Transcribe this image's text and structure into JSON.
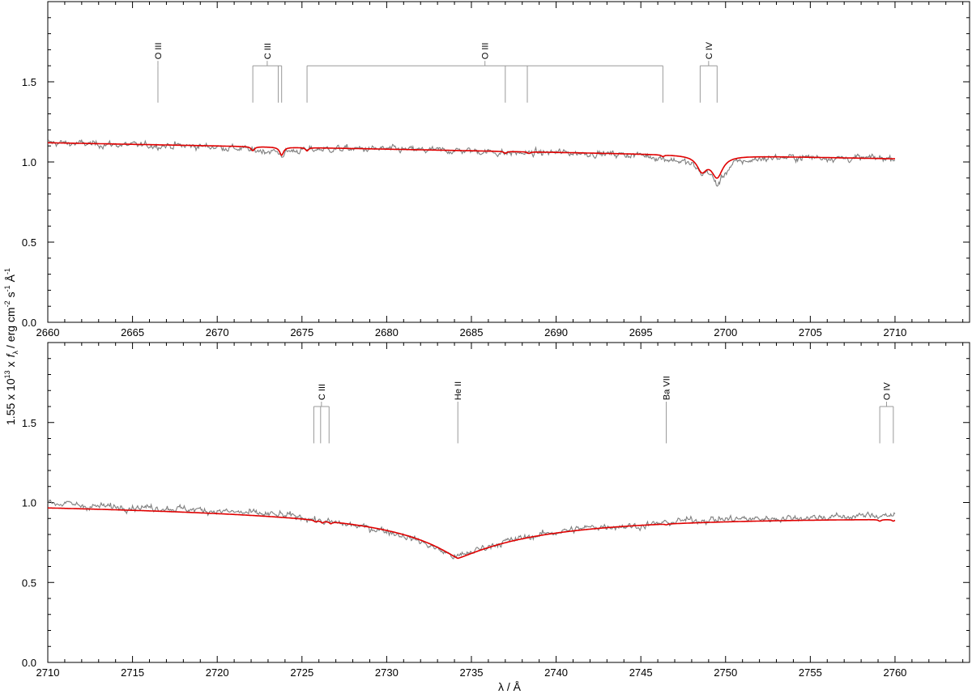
{
  "figure": {
    "ylabel_prefix": "1.55 x 10",
    "ylabel_exp13": "13",
    "ylabel_x": "x",
    "ylabel_f": "f",
    "ylabel_lambda_sub": "λ",
    "ylabel_units": "/ erg cm",
    "ylabel_exp_m2": "-2",
    "ylabel_s": "s",
    "ylabel_exp_m1a": "-1",
    "ylabel_A": "Å",
    "ylabel_exp_m1b": "-1",
    "xlabel": "λ / Å"
  },
  "colors": {
    "observed": "#7f7f7f",
    "model": "#e00000",
    "id_marks": "#9a9a9a",
    "axes": "#000000"
  },
  "chart_data": [
    {
      "type": "line",
      "panel": "top",
      "xlim": [
        2660,
        2714.4
      ],
      "ylim": [
        0.0,
        2.0
      ],
      "xticks": [
        2660,
        2665,
        2670,
        2675,
        2680,
        2685,
        2690,
        2695,
        2700,
        2705,
        2710
      ],
      "yticks": [
        0.0,
        0.5,
        1.0,
        1.5
      ],
      "ytick_labels": [
        "0.0",
        "0.5",
        "1.0",
        "1.5"
      ],
      "data_range": [
        2660,
        2710
      ],
      "series": [
        {
          "role": "observed",
          "style": "noisy grey",
          "x": [
            2660.0,
            2662.5,
            2665.0,
            2667.5,
            2670.0,
            2672.2,
            2673.8,
            2675.3,
            2677.5,
            2680.0,
            2682.5,
            2685.0,
            2687.0,
            2688.4,
            2690.0,
            2692.5,
            2695.0,
            2696.3,
            2698.0,
            2698.6,
            2699.0,
            2699.5,
            2700.5,
            2702.5,
            2705.0,
            2707.5,
            2710.0
          ],
          "y": [
            1.12,
            1.11,
            1.1,
            1.1,
            1.09,
            1.06,
            1.04,
            1.07,
            1.08,
            1.08,
            1.07,
            1.07,
            1.05,
            1.05,
            1.06,
            1.05,
            1.04,
            1.01,
            0.96,
            0.92,
            0.93,
            0.82,
            0.97,
            1.02,
            1.03,
            1.02,
            1.03
          ]
        },
        {
          "role": "model",
          "style": "smooth red",
          "continuum": [
            [
              2660,
              1.12
            ],
            [
              2710,
              1.02
            ]
          ],
          "lines": [
            {
              "x": 2672.1,
              "depth": 0.025,
              "width": 0.12
            },
            {
              "x": 2673.8,
              "depth": 0.05,
              "width": 0.14
            },
            {
              "x": 2675.3,
              "depth": 0.02,
              "width": 0.1
            },
            {
              "x": 2687.0,
              "depth": 0.012,
              "width": 0.1
            },
            {
              "x": 2688.4,
              "depth": 0.01,
              "width": 0.1
            },
            {
              "x": 2696.3,
              "depth": 0.01,
              "width": 0.1
            },
            {
              "x": 2698.6,
              "depth": 0.09,
              "width": 0.35
            },
            {
              "x": 2699.5,
              "depth": 0.13,
              "width": 0.4
            }
          ]
        }
      ],
      "line_ids": [
        {
          "label": "O III",
          "lines": [
            2666.5
          ]
        },
        {
          "label": "C III",
          "lines": [
            2672.1,
            2673.6,
            2673.8
          ]
        },
        {
          "label": "O III",
          "lines": [
            2675.3,
            2687.0,
            2688.3,
            2696.3
          ]
        },
        {
          "label": "C IV",
          "lines": [
            2698.5,
            2699.5
          ]
        }
      ]
    },
    {
      "type": "line",
      "panel": "bottom",
      "xlim": [
        2710,
        2764.4
      ],
      "ylim": [
        0.0,
        2.0
      ],
      "xticks": [
        2710,
        2715,
        2720,
        2725,
        2730,
        2735,
        2740,
        2745,
        2750,
        2755,
        2760
      ],
      "yticks": [
        0.0,
        0.5,
        1.0,
        1.5
      ],
      "ytick_labels": [
        "0.0",
        "0.5",
        "1.0",
        "1.5"
      ],
      "data_range": [
        2710,
        2760
      ],
      "series": [
        {
          "role": "observed",
          "style": "noisy grey",
          "x": [
            2710.0,
            2712.5,
            2715.0,
            2717.5,
            2720.0,
            2722.5,
            2725.0,
            2726.3,
            2727.5,
            2730.0,
            2731.5,
            2733.0,
            2734.0,
            2735.0,
            2736.5,
            2738.0,
            2740.0,
            2742.5,
            2745.0,
            2746.5,
            2747.5,
            2750.0,
            2752.5,
            2755.0,
            2757.5,
            2759.5,
            2760.0
          ],
          "y": [
            1.03,
            0.99,
            0.99,
            0.98,
            0.96,
            0.94,
            0.92,
            0.88,
            0.86,
            0.82,
            0.77,
            0.7,
            0.66,
            0.7,
            0.75,
            0.78,
            0.82,
            0.86,
            0.85,
            0.88,
            0.9,
            0.91,
            0.91,
            0.92,
            0.93,
            0.95,
            0.93
          ]
        },
        {
          "role": "model",
          "style": "smooth red",
          "continuum": [
            [
              2710,
              1.0
            ],
            [
              2760,
              0.94
            ]
          ],
          "lines": [
            {
              "x": 2734.2,
              "depth": 0.32,
              "width": 0.0
            },
            {
              "x": 2725.8,
              "depth": 0.01,
              "width": 0.1
            },
            {
              "x": 2726.2,
              "depth": 0.012,
              "width": 0.1
            },
            {
              "x": 2726.7,
              "depth": 0.012,
              "width": 0.1
            },
            {
              "x": 2746.5,
              "depth": 0.005,
              "width": 0.1
            },
            {
              "x": 2759.1,
              "depth": 0.01,
              "width": 0.1
            },
            {
              "x": 2759.9,
              "depth": 0.01,
              "width": 0.1
            }
          ]
        }
      ],
      "line_ids": [
        {
          "label": "C III",
          "lines": [
            2725.7,
            2726.1,
            2726.6
          ]
        },
        {
          "label": "He II",
          "lines": [
            2734.2
          ]
        },
        {
          "label": "Ba VII",
          "lines": [
            2746.5
          ]
        },
        {
          "label": "O IV",
          "lines": [
            2759.1,
            2759.9
          ]
        }
      ]
    }
  ]
}
